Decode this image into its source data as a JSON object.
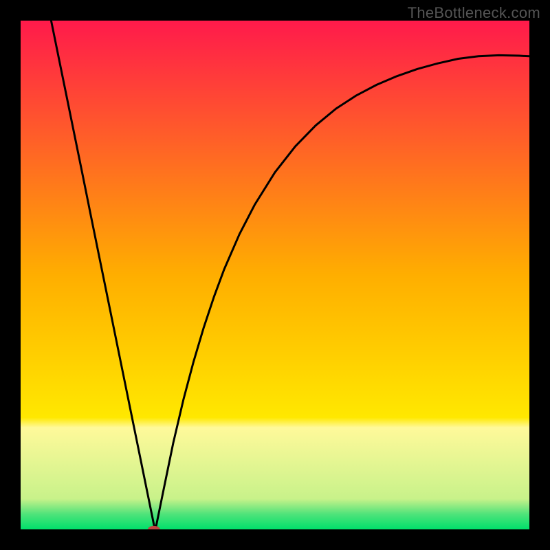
{
  "watermark": "TheBottleneck.com",
  "chart_data": {
    "type": "line",
    "title": "",
    "xlabel": "",
    "ylabel": "",
    "xlim": [
      0,
      1
    ],
    "ylim": [
      0,
      1
    ],
    "grid": false,
    "legend": false,
    "background_gradient": {
      "stops": [
        {
          "pos": 0.0,
          "color": "#ff1a4b"
        },
        {
          "pos": 0.5,
          "color": "#ffae00"
        },
        {
          "pos": 0.78,
          "color": "#ffe800"
        },
        {
          "pos": 0.8,
          "color": "#fff99a"
        },
        {
          "pos": 0.94,
          "color": "#c8f28a"
        },
        {
          "pos": 0.97,
          "color": "#4fe37a"
        },
        {
          "pos": 1.0,
          "color": "#00e06b"
        }
      ]
    },
    "series": [
      {
        "name": "curve",
        "color": "#000000",
        "stroke_width": 3,
        "x": [
          0.06,
          0.08,
          0.1,
          0.12,
          0.14,
          0.16,
          0.18,
          0.2,
          0.22,
          0.24,
          0.25,
          0.26,
          0.262,
          0.265,
          0.27,
          0.28,
          0.3,
          0.32,
          0.34,
          0.36,
          0.38,
          0.4,
          0.43,
          0.46,
          0.5,
          0.54,
          0.58,
          0.62,
          0.66,
          0.7,
          0.74,
          0.78,
          0.82,
          0.86,
          0.9,
          0.94,
          0.98,
          1.0
        ],
        "y": [
          1.0,
          0.902,
          0.804,
          0.706,
          0.607,
          0.509,
          0.411,
          0.313,
          0.215,
          0.117,
          0.068,
          0.019,
          0.009,
          0.0,
          0.024,
          0.073,
          0.17,
          0.255,
          0.33,
          0.397,
          0.457,
          0.511,
          0.58,
          0.638,
          0.702,
          0.753,
          0.794,
          0.827,
          0.853,
          0.874,
          0.891,
          0.905,
          0.916,
          0.925,
          0.93,
          0.932,
          0.931,
          0.93
        ]
      }
    ],
    "minimum_marker": {
      "x": 0.262,
      "y": 0.0,
      "rx": 0.012,
      "ry": 0.007,
      "color": "#c0423f"
    }
  }
}
